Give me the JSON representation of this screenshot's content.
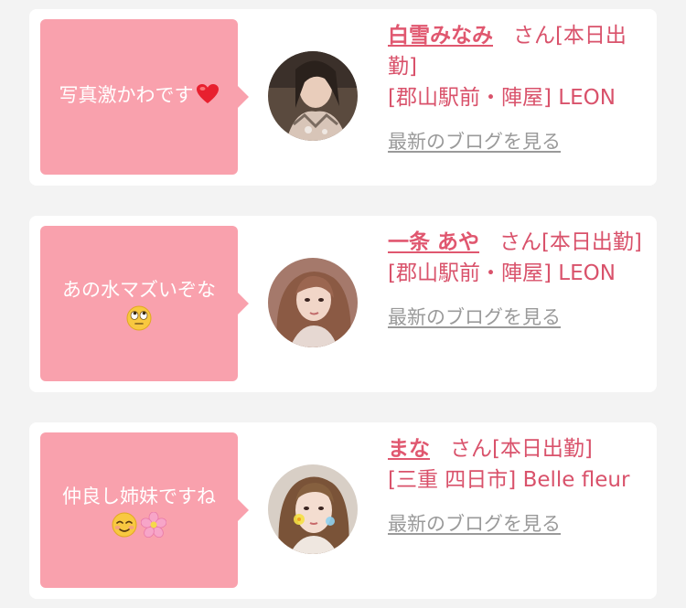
{
  "colors": {
    "bubble": "#f9a1ad",
    "name": "#e0576f",
    "text": "#d9526b",
    "link": "#9a9a9a",
    "card": "#ffffff",
    "background": "#f3f3f3"
  },
  "cards": [
    {
      "comment": "写真激かわです",
      "comment_line2": "",
      "comment_emoji": [
        "heart-emoji"
      ],
      "name": "白雪みなみ",
      "honorific": "さん",
      "status": "[本日出勤]",
      "area": "[郡山駅前・陣屋]",
      "shop": "LEON",
      "blog_link": "最新のブログを見る"
    },
    {
      "comment": "あの水マズいぞな",
      "comment_line2": "",
      "comment_emoji": [
        "rolling-eyes-emoji"
      ],
      "name": "一条 あや",
      "honorific": "さん",
      "status": "[本日出勤]",
      "area": "[郡山駅前・陣屋]",
      "shop": "LEON",
      "blog_link": "最新のブログを見る"
    },
    {
      "comment": "仲良し姉妹ですね",
      "comment_line2": "",
      "comment_emoji": [
        "relieved-smile-emoji",
        "cherry-blossom-emoji"
      ],
      "name": "まな",
      "honorific": "さん",
      "status": "[本日出勤]",
      "area": "[三重 四日市]",
      "shop": "Belle fleur",
      "blog_link": "最新のブログを見る"
    }
  ]
}
